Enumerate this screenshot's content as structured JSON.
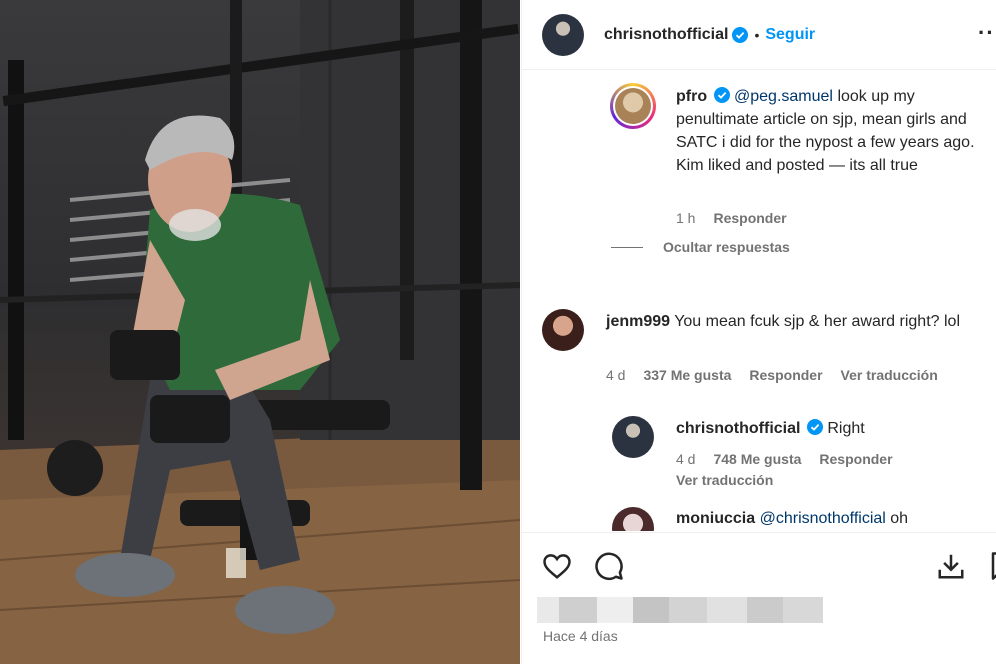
{
  "header": {
    "username": "chrisnothofficial",
    "follow_label": "Seguir",
    "separator": "•",
    "more": "···"
  },
  "comments": [
    {
      "username": "pfro",
      "mention": "@peg.samuel",
      "text": "look up my penultimate article on sjp, mean girls and SATC i did for the nypost a few years ago. Kim liked and posted — its all true",
      "time": "1 h",
      "reply_label": "Responder"
    },
    {
      "username": "jenm999",
      "text": "You mean fcuk sjp & her award right? lol",
      "time": "4 d",
      "likes": "337 Me gusta",
      "reply_label": "Responder",
      "translate_label": "Ver traducción"
    },
    {
      "username": "chrisnothofficial",
      "text": "Right",
      "time": "4 d",
      "likes": "748 Me gusta",
      "reply_label": "Responder",
      "translate_label": "Ver traducción"
    },
    {
      "username": "moniuccia",
      "mention": "@chrisnothofficial",
      "text": "oh"
    }
  ],
  "hide_replies_label": "Ocultar respuestas",
  "footer": {
    "time_ago": "Hace 4 días"
  },
  "colors": {
    "link_blue": "#0095f6",
    "mention_blue": "#00376b",
    "secondary_text": "#737373",
    "verified_blue": "#0095f6"
  },
  "icons": [
    "heart-icon",
    "comment-icon",
    "download-icon",
    "bookmark-icon",
    "verified-icon"
  ]
}
